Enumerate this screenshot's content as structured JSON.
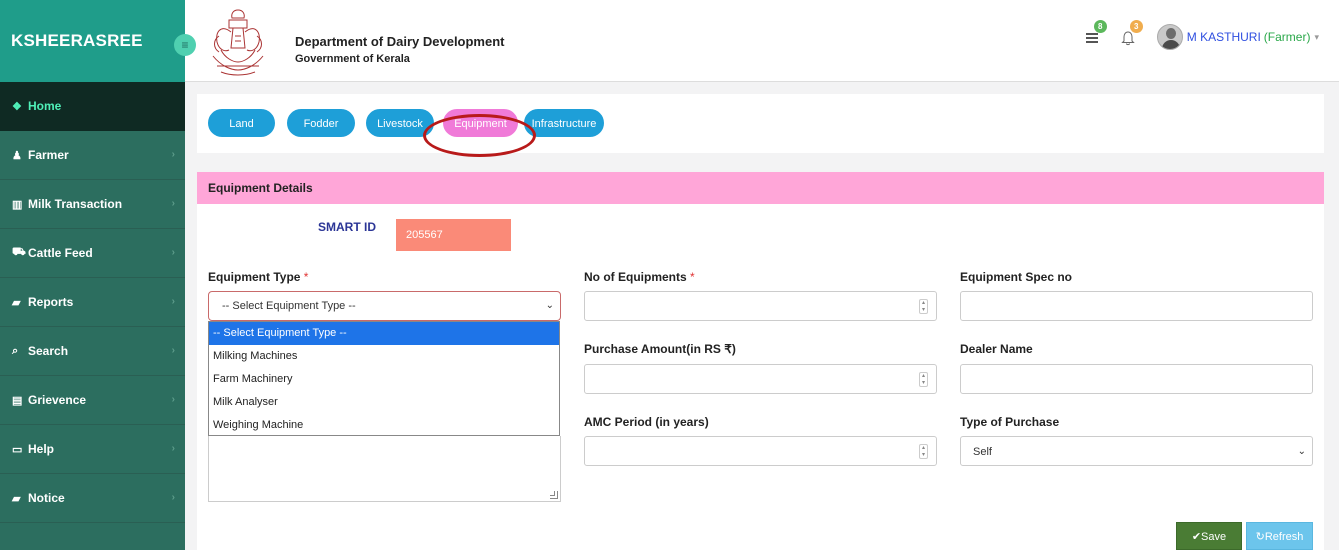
{
  "brand": {
    "title": "KSHEERASREE",
    "toggle_icon": "≡"
  },
  "sidebar": {
    "items": [
      {
        "label": "Home",
        "icon": "home-icon",
        "glyph": "❖",
        "active": true
      },
      {
        "label": "Farmer",
        "icon": "user-icon",
        "glyph": "♟"
      },
      {
        "label": "Milk Transaction",
        "icon": "chart-icon",
        "glyph": "▥"
      },
      {
        "label": "Cattle Feed",
        "icon": "cart-icon",
        "glyph": "⛟"
      },
      {
        "label": "Reports",
        "icon": "book-icon",
        "glyph": "▰"
      },
      {
        "label": "Search",
        "icon": "search-icon",
        "glyph": "⌕"
      },
      {
        "label": "Grievence",
        "icon": "list-icon",
        "glyph": "▤"
      },
      {
        "label": "Help",
        "icon": "desktop-icon",
        "glyph": "▭"
      },
      {
        "label": "Notice",
        "icon": "book-icon",
        "glyph": "▰"
      }
    ]
  },
  "header": {
    "dept_title": "Department of Dairy Development",
    "dept_subtitle": "Government of Kerala",
    "messages_badge": "8",
    "notifications_badge": "3",
    "user_name": "M KASTHURI",
    "user_role": "(Farmer)",
    "colors": {
      "messages_badge": "#5cb85c",
      "notifications_badge": "#f0ad4e"
    }
  },
  "tabs": [
    {
      "label": "Land"
    },
    {
      "label": "Fodder"
    },
    {
      "label": "Livestock"
    },
    {
      "label": "Equipment",
      "active": true
    },
    {
      "label": "Infrastructure"
    }
  ],
  "panel": {
    "title": "Equipment Details"
  },
  "form": {
    "smart_id_label": "SMART ID",
    "smart_id_value": "205567",
    "equipment_type_label": "Equipment Type",
    "required_mark": "*",
    "equipment_type_value": "-- Select Equipment Type --",
    "equipment_type_options": [
      "-- Select Equipment Type --",
      "Milking Machines",
      "Farm Machinery",
      "Milk Analyser",
      "Weighing Machine"
    ],
    "no_of_equipments_label": "No of Equipments",
    "equipment_spec_label": "Equipment Spec no",
    "purchase_amount_label": "Purchase Amount(in RS ₹)",
    "dealer_name_label": "Dealer Name",
    "amc_period_label": "AMC Period (in years)",
    "type_of_purchase_label": "Type of Purchase",
    "type_of_purchase_value": "Self"
  },
  "actions": {
    "save": "✔Save",
    "refresh": "↻Refresh"
  }
}
